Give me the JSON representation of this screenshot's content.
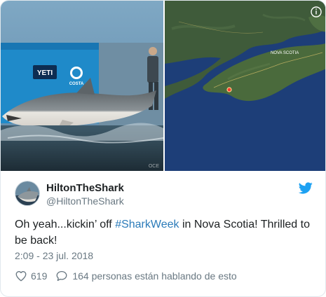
{
  "media": {
    "photo_overlay_text": [
      "YETI",
      "COSTA"
    ],
    "map_region_label": "NOVA SCOTIA",
    "info_icon": "info-circle-icon"
  },
  "author": {
    "display_name": "HiltonTheShark",
    "handle": "@HiltonTheShark",
    "avatar_icon": "shark-avatar",
    "platform_icon": "twitter-bird-icon",
    "platform_color": "#1da1f2"
  },
  "tweet": {
    "text_before": "Oh yeah...kickin’ off ",
    "hashtag": "#SharkWeek",
    "text_after": " in Nova Scotia! Thrilled to be back!",
    "hashtag_color": "#2b7bb9",
    "timestamp": "2:09 - 23 jul. 2018"
  },
  "actions": {
    "like_icon": "heart-outline-icon",
    "like_count": "619",
    "reply_icon": "speech-bubble-icon",
    "conversation_text": "164 personas están hablando de esto"
  }
}
